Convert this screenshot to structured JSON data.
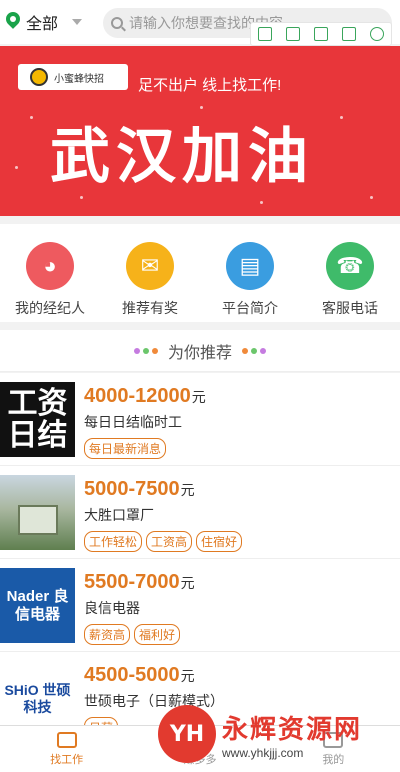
{
  "topbar": {
    "location": "全部",
    "search_placeholder": "请输入你想要查找的内容"
  },
  "overlay_tools": [
    "copy-icon",
    "expand-icon",
    "save-icon",
    "share-icon",
    "settings-icon"
  ],
  "banner": {
    "logo_text": "小蜜蜂快招",
    "slogan": "足不出户 线上找工作!",
    "headline": "武汉加油"
  },
  "nav": [
    {
      "label": "我的经纪人",
      "icon": "headset-icon",
      "color": "#ee5a5f",
      "glyph": "◕"
    },
    {
      "label": "推荐有奖",
      "icon": "gift-icon",
      "color": "#f6b21a",
      "glyph": "✉"
    },
    {
      "label": "平台简介",
      "icon": "card-icon",
      "color": "#3a9de0",
      "glyph": "▤"
    },
    {
      "label": "客服电话",
      "icon": "phone-icon",
      "color": "#3fbb6a",
      "glyph": "☎"
    }
  ],
  "recommend": {
    "title": "为你推荐"
  },
  "jobs": [
    {
      "salary": "4000-12000",
      "unit": "元",
      "company": "每日日结临时工",
      "tags": [
        "每日最新消息"
      ],
      "logo": "工资日结",
      "logo_bg": "#111111",
      "logo_color": "#ffffff"
    },
    {
      "salary": "5000-7500",
      "unit": "元",
      "company": "大胜口罩厂",
      "tags": [
        "工作轻松",
        "工资高",
        "住宿好"
      ],
      "logo": "",
      "logo_bg": "#7a8f6a",
      "logo_color": "#ffffff"
    },
    {
      "salary": "5500-7000",
      "unit": "元",
      "company": "良信电器",
      "tags": [
        "薪资高",
        "福利好"
      ],
      "logo": "Nader 良信电器",
      "logo_bg": "#1a5aa8",
      "logo_color": "#ffffff"
    },
    {
      "salary": "4500-5000",
      "unit": "元",
      "company": "世硕电子（日薪模式）",
      "tags": [
        "日薪"
      ],
      "logo": "SHiO 世硕科技",
      "logo_bg": "#ffffff",
      "logo_color": "#1a4a9e"
    }
  ],
  "tabbar": [
    {
      "label": "找工作",
      "active": true
    },
    {
      "label": "赚多多",
      "active": false
    },
    {
      "label": "我的",
      "active": false
    }
  ],
  "watermark": {
    "mark": "YH",
    "cn": "永辉资源网",
    "url": "www.yhkjjj.com"
  }
}
